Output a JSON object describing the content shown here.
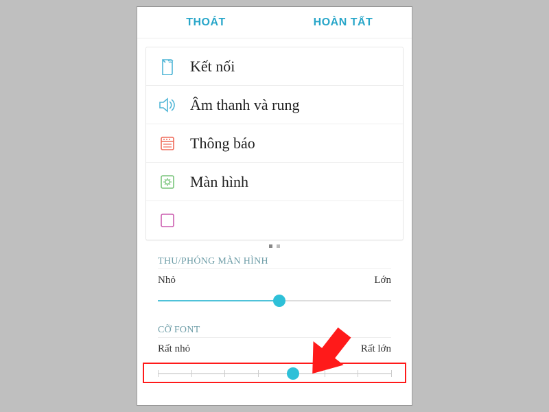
{
  "colors": {
    "accent": "#28a6c9",
    "thumb": "#2ec0d8",
    "highlight": "#ff1a1a",
    "iconBlue": "#4fb5d6",
    "iconRed": "#ef6b5a",
    "iconGreen": "#78c47a"
  },
  "header": {
    "left": "THOÁT",
    "right": "HOÀN TẤT"
  },
  "settings_list": {
    "items": [
      {
        "icon": "connection-icon",
        "label": "Kết nối"
      },
      {
        "icon": "sound-icon",
        "label": "Âm thanh và rung"
      },
      {
        "icon": "notification-icon",
        "label": "Thông báo"
      },
      {
        "icon": "display-icon",
        "label": "Màn hình"
      }
    ]
  },
  "pager": {
    "count": 2,
    "active": 0
  },
  "zoom": {
    "title": "THU/PHÓNG MÀN HÌNH",
    "min_label": "Nhỏ",
    "max_label": "Lớn",
    "value_pct": 52
  },
  "font": {
    "title": "CỠ FONT",
    "min_label": "Rất nhỏ",
    "max_label": "Rất lớn",
    "value_pct": 58,
    "ticks": 8
  }
}
